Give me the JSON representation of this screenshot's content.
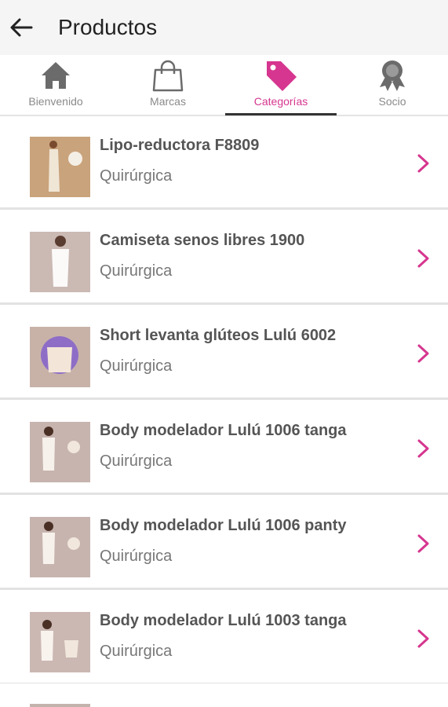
{
  "header": {
    "title": "Productos"
  },
  "colors": {
    "accent": "#d6368f",
    "inactive": "#8a8a8a"
  },
  "tabs": [
    {
      "label": "Bienvenido",
      "icon": "home-icon"
    },
    {
      "label": "Marcas",
      "icon": "shopping-bag-icon"
    },
    {
      "label": "Categorías",
      "icon": "tag-icon",
      "active": true
    },
    {
      "label": "Socio",
      "icon": "award-ribbon-icon"
    }
  ],
  "products": [
    {
      "name": "Lipo-reductora F8809",
      "category": "Quirúrgica"
    },
    {
      "name": "Camiseta senos libres 1900",
      "category": "Quirúrgica"
    },
    {
      "name": "Short levanta glúteos Lulú 6002",
      "category": "Quirúrgica"
    },
    {
      "name": "Body modelador Lulú 1006 tanga",
      "category": "Quirúrgica"
    },
    {
      "name": "Body modelador Lulú 1006 panty",
      "category": "Quirúrgica"
    },
    {
      "name": "Body modelador Lulú 1003 tanga",
      "category": "Quirúrgica"
    }
  ]
}
